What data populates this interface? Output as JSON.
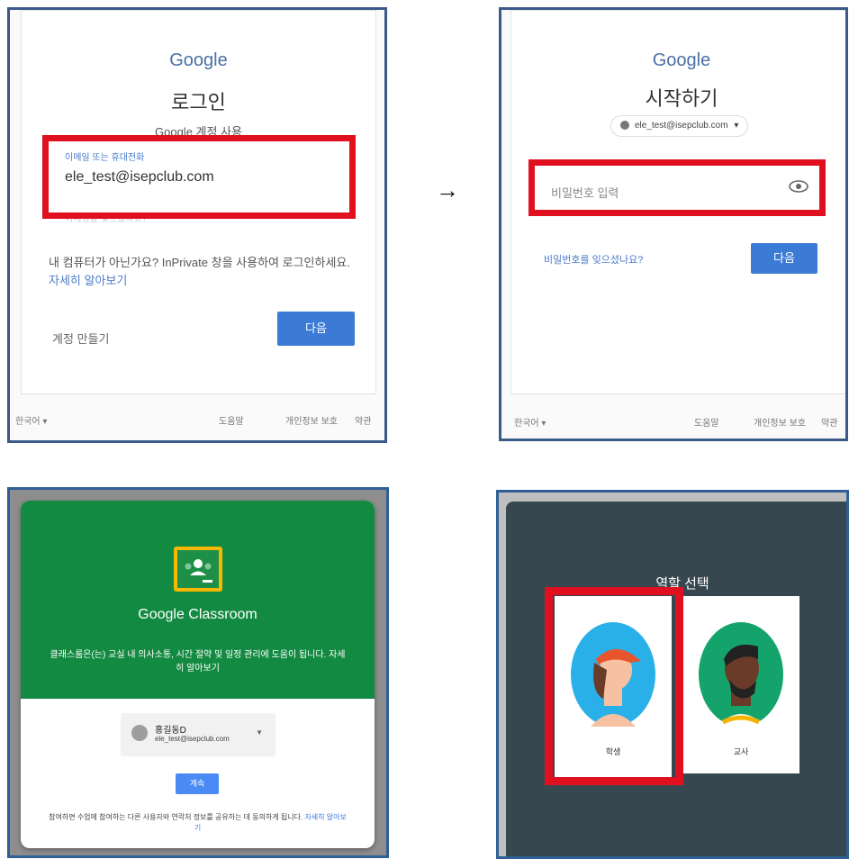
{
  "arrow": "→",
  "signin": {
    "logo": "Google",
    "title": "로그인",
    "subtitle": "Google 계정 사용",
    "email_label": "이메일 또는 휴대전화",
    "email_value": "ele_test@isepclub.com",
    "forgot_email": "이메일을 잊으셨나요?",
    "private_hint": "내 컴퓨터가 아닌가요? InPrivate 창을 사용하여 로그인하세요.",
    "learn_more": "자세히 알아보기",
    "create_account": "계정 만들기",
    "next_button": "다음",
    "footer_language": "한국어 ▾",
    "footer_help": "도움말",
    "footer_privacy": "개인정보 보호",
    "footer_terms": "약관"
  },
  "password": {
    "logo": "Google",
    "title": "시작하기",
    "account_chip": "ele_test@isepclub.com",
    "password_placeholder": "비밀번호 입력",
    "forgot_password": "비밀번호를 잊으셨나요?",
    "next_button": "다음",
    "footer_language": "한국어 ▾",
    "footer_help": "도움말",
    "footer_privacy": "개인정보 보호",
    "footer_terms": "약관"
  },
  "classroom": {
    "product_name": "Google Classroom",
    "description": "클래스룸은(는) 교실 내 의사소통, 시간 절약 및 일정 관리에 도움이 됩니다.",
    "description_link": "자세히 알아보기",
    "account_name": "홍길동D",
    "account_email": "ele_test@isepclub.com",
    "continue_button": "계속",
    "footer_text": "참여하면 수업에 참여하는 다른 사용자와 연락처 정보를 공유하는 데 동의하게 됩니다.",
    "footer_link": "자세히 알아보기"
  },
  "roles": {
    "title": "역할 선택",
    "student_label": "학생",
    "teacher_label": "교사"
  },
  "colors": {
    "highlight_red": "#e01020",
    "google_blue": "#3b7bd6",
    "classroom_green": "#138a41",
    "role_background": "#37474f"
  }
}
